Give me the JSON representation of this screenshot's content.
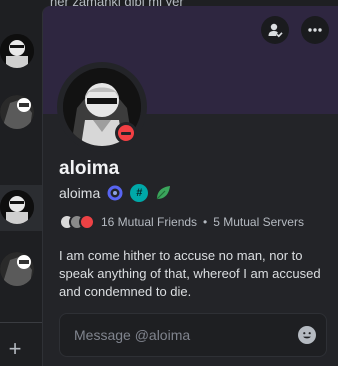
{
  "background": {
    "top_text": "ner zamanki gibi mi yer"
  },
  "popout": {
    "display_name": "aloima",
    "username": "aloima",
    "mutual": {
      "friends": "16 Mutual Friends",
      "separator": "•",
      "servers": "5 Mutual Servers"
    },
    "bio": "I am come hither to accuse no man, nor to speak anything of that, whereof I am accused and condemned to die.",
    "message_placeholder": "Message @aloima",
    "badges": [
      {
        "icon": "hypesquad-balance-icon",
        "color": "#5865f2"
      },
      {
        "icon": "hash-icon",
        "color": "#00a8a8"
      },
      {
        "icon": "leaf-icon",
        "color": "#3ba55c"
      }
    ],
    "status_color": "#f23f43",
    "banner_color": "#2e2640"
  },
  "sidebar": {
    "add_label": "+"
  }
}
